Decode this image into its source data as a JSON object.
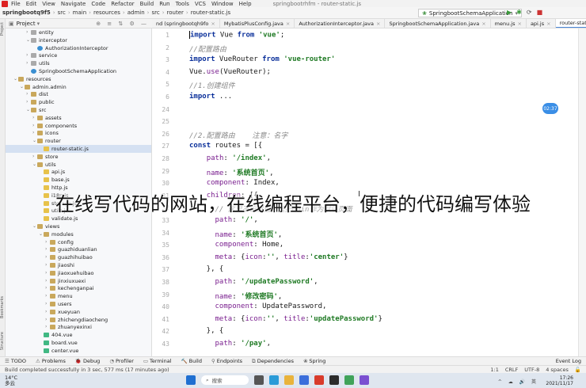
{
  "menubar": {
    "items": [
      "File",
      "Edit",
      "View",
      "Navigate",
      "Code",
      "Refactor",
      "Build",
      "Run",
      "Tools",
      "VCS",
      "Window",
      "Help"
    ],
    "window_title": "springbootrhfm - router-static.js"
  },
  "breadcrumbs": [
    "springbootq9f5",
    "src",
    "main",
    "resources",
    "admin",
    "src",
    "router",
    "router-static.js"
  ],
  "run_config": "SpringbootSchemaApplication",
  "run_buttons": [
    "▶",
    "✱",
    "⟳",
    "■"
  ],
  "project_panel": {
    "title": "Project",
    "toolbar_icons": "⊕ ≡ ⇅ ⚙ —"
  },
  "left_strip_labels": [
    "Project",
    "Bookmarks",
    "Structure"
  ],
  "tree": [
    {
      "label": "entity",
      "depth": 3,
      "type": "pkg",
      "arrow": "›"
    },
    {
      "label": "interceptor",
      "depth": 3,
      "type": "pkg",
      "arrow": "⌄"
    },
    {
      "label": "AuthorizationInterceptor",
      "depth": 4,
      "type": "cls",
      "arrow": ""
    },
    {
      "label": "service",
      "depth": 3,
      "type": "pkg",
      "arrow": "›"
    },
    {
      "label": "utils",
      "depth": 3,
      "type": "pkg",
      "arrow": "›"
    },
    {
      "label": "SpringbootSchemaApplication",
      "depth": 3,
      "type": "cls",
      "arrow": ""
    },
    {
      "label": "resources",
      "depth": 1,
      "type": "folder",
      "arrow": "⌄"
    },
    {
      "label": "admin.admin",
      "depth": 2,
      "type": "folder",
      "arrow": "⌄"
    },
    {
      "label": "dist",
      "depth": 3,
      "type": "folder",
      "arrow": "›"
    },
    {
      "label": "public",
      "depth": 3,
      "type": "folder",
      "arrow": "›"
    },
    {
      "label": "src",
      "depth": 3,
      "type": "folder",
      "arrow": "⌄"
    },
    {
      "label": "assets",
      "depth": 4,
      "type": "folder",
      "arrow": "›"
    },
    {
      "label": "components",
      "depth": 4,
      "type": "folder",
      "arrow": "›"
    },
    {
      "label": "icons",
      "depth": 4,
      "type": "folder",
      "arrow": "›"
    },
    {
      "label": "router",
      "depth": 4,
      "type": "folder",
      "arrow": "⌄"
    },
    {
      "label": "router-static.js",
      "depth": 5,
      "type": "js",
      "arrow": "",
      "selected": true
    },
    {
      "label": "store",
      "depth": 4,
      "type": "folder",
      "arrow": "›"
    },
    {
      "label": "utils",
      "depth": 4,
      "type": "folder",
      "arrow": "⌄"
    },
    {
      "label": "api.js",
      "depth": 5,
      "type": "js",
      "arrow": ""
    },
    {
      "label": "base.js",
      "depth": 5,
      "type": "js",
      "arrow": ""
    },
    {
      "label": "http.js",
      "depth": 5,
      "type": "js",
      "arrow": ""
    },
    {
      "label": "i18n.js",
      "depth": 5,
      "type": "js",
      "arrow": ""
    },
    {
      "label": "storage.js",
      "depth": 5,
      "type": "js",
      "arrow": ""
    },
    {
      "label": "utils.js",
      "depth": 5,
      "type": "js",
      "arrow": ""
    },
    {
      "label": "validate.js",
      "depth": 5,
      "type": "js",
      "arrow": ""
    },
    {
      "label": "views",
      "depth": 4,
      "type": "folder",
      "arrow": "⌄"
    },
    {
      "label": "modules",
      "depth": 5,
      "type": "folder",
      "arrow": "⌄"
    },
    {
      "label": "config",
      "depth": 6,
      "type": "folder",
      "arrow": "›"
    },
    {
      "label": "guazhiduanlian",
      "depth": 6,
      "type": "folder",
      "arrow": "›"
    },
    {
      "label": "guazhihuibao",
      "depth": 6,
      "type": "folder",
      "arrow": "›"
    },
    {
      "label": "jiaoshi",
      "depth": 6,
      "type": "folder",
      "arrow": "›"
    },
    {
      "label": "jiaoxuehuibao",
      "depth": 6,
      "type": "folder",
      "arrow": "›"
    },
    {
      "label": "jinxiuxuexi",
      "depth": 6,
      "type": "folder",
      "arrow": "›"
    },
    {
      "label": "kechenganpai",
      "depth": 6,
      "type": "folder",
      "arrow": "›"
    },
    {
      "label": "menu",
      "depth": 6,
      "type": "folder",
      "arrow": "›"
    },
    {
      "label": "users",
      "depth": 6,
      "type": "folder",
      "arrow": "›"
    },
    {
      "label": "xueyuan",
      "depth": 6,
      "type": "folder",
      "arrow": "›"
    },
    {
      "label": "zhichengdiaocheng",
      "depth": 6,
      "type": "folder",
      "arrow": "›"
    },
    {
      "label": "zhuanyexinxi",
      "depth": 6,
      "type": "folder",
      "arrow": "›"
    },
    {
      "label": "404.vue",
      "depth": 5,
      "type": "vue",
      "arrow": ""
    },
    {
      "label": "board.vue",
      "depth": 5,
      "type": "vue",
      "arrow": ""
    },
    {
      "label": "center.vue",
      "depth": 5,
      "type": "vue",
      "arrow": ""
    }
  ],
  "tabs": [
    {
      "label": "nd (springbootqh9fo",
      "active": false
    },
    {
      "label": "MybatisPlusConfig.java",
      "active": false
    },
    {
      "label": "AuthorizationInterceptor.java",
      "active": false
    },
    {
      "label": "SpringbootSchemaApplication.java",
      "active": false
    },
    {
      "label": "menu.js",
      "active": false
    },
    {
      "label": "api.js",
      "active": false
    },
    {
      "label": "router-static.js",
      "active": true
    }
  ],
  "code_lines": [
    {
      "n": "1",
      "html": "<span class=\"caret\"></span><span class=\"kw\">import</span> Vue <span class=\"kw\">from</span> <span class=\"str\">'vue'</span>;"
    },
    {
      "n": "2",
      "html": "<span class=\"cmt\">//配置路由</span>"
    },
    {
      "n": "3",
      "html": "<span class=\"kw\">import</span> VueRouter <span class=\"kw\">from</span> <span class=\"str\">'vue-router'</span>"
    },
    {
      "n": "4",
      "html": "Vue.<span class=\"prop\">use</span>(VueRouter);"
    },
    {
      "n": "5",
      "html": "<span class=\"cmt\">//1.创建组件</span>"
    },
    {
      "n": "6",
      "html": "<span class=\"kw\">import</span> ..."
    },
    {
      "n": "24",
      "html": ""
    },
    {
      "n": "25",
      "html": ""
    },
    {
      "n": "26",
      "html": "<span class=\"cmt\">//2.配置路由    注意：名字</span>"
    },
    {
      "n": "27",
      "html": "<span class=\"kw\">const</span> routes = [{"
    },
    {
      "n": "28",
      "html": "    <span class=\"prop\">path</span>: <span class=\"str\">'/index'</span>,"
    },
    {
      "n": "29",
      "html": "    <span class=\"prop\">name</span>: <span class=\"str\">'系统首页'</span>,"
    },
    {
      "n": "30",
      "html": "    <span class=\"prop\">component</span>: Index,"
    },
    {
      "n": "31",
      "html": "    <span class=\"prop\">children</span>: [{"
    },
    {
      "n": "32",
      "html": "      <span class=\"cmt\">// 这里不设置值，是把main作为默认页面</span>"
    },
    {
      "n": "33",
      "html": "      <span class=\"prop\">path</span>: <span class=\"str\">'/'</span>,"
    },
    {
      "n": "34",
      "html": "      <span class=\"prop\">name</span>: <span class=\"str\">'系统首页'</span>,"
    },
    {
      "n": "35",
      "html": "      <span class=\"prop\">component</span>: Home,"
    },
    {
      "n": "36",
      "html": "      <span class=\"prop\">meta</span>: {<span class=\"prop\">icon</span>:<span class=\"str\">''</span>, <span class=\"prop\">title</span>:<span class=\"str\">'center'</span>}"
    },
    {
      "n": "37",
      "html": "    }, {"
    },
    {
      "n": "38",
      "html": "      <span class=\"prop\">path</span>: <span class=\"str\">'/updatePassword'</span>,"
    },
    {
      "n": "39",
      "html": "      <span class=\"prop\">name</span>: <span class=\"str\">'修改密码'</span>,"
    },
    {
      "n": "40",
      "html": "      <span class=\"prop\">component</span>: UpdatePassword,"
    },
    {
      "n": "41",
      "html": "      <span class=\"prop\">meta</span>: {<span class=\"prop\">icon</span>:<span class=\"str\">''</span>, <span class=\"prop\">title</span>:<span class=\"str\">'updatePassword'</span>}"
    },
    {
      "n": "42",
      "html": "    }, {"
    },
    {
      "n": "43",
      "html": "      <span class=\"prop\">path</span>: <span class=\"str\">'/pay'</span>,"
    }
  ],
  "time_bubble": "02:37",
  "overlay_caption": "在线写代码的网站，在线编程平台，便捷的代码编写体验",
  "bottom_tools": [
    "TODO",
    "Problems",
    "Debug",
    "Profiler",
    "Terminal",
    "Build",
    "Endpoints",
    "Dependencies",
    "Spring"
  ],
  "event_log": "Event Log",
  "status": {
    "message": "Build completed successfully in 3 sec, 577 ms (17 minutes ago)",
    "position": "1:1",
    "line_sep": "CRLF",
    "encoding": "UTF-8",
    "indent": "4 spaces"
  },
  "taskbar": {
    "temp": "14°C",
    "weather": "多云",
    "search": "搜索",
    "time": "17:26",
    "date": "2021/11/17"
  }
}
